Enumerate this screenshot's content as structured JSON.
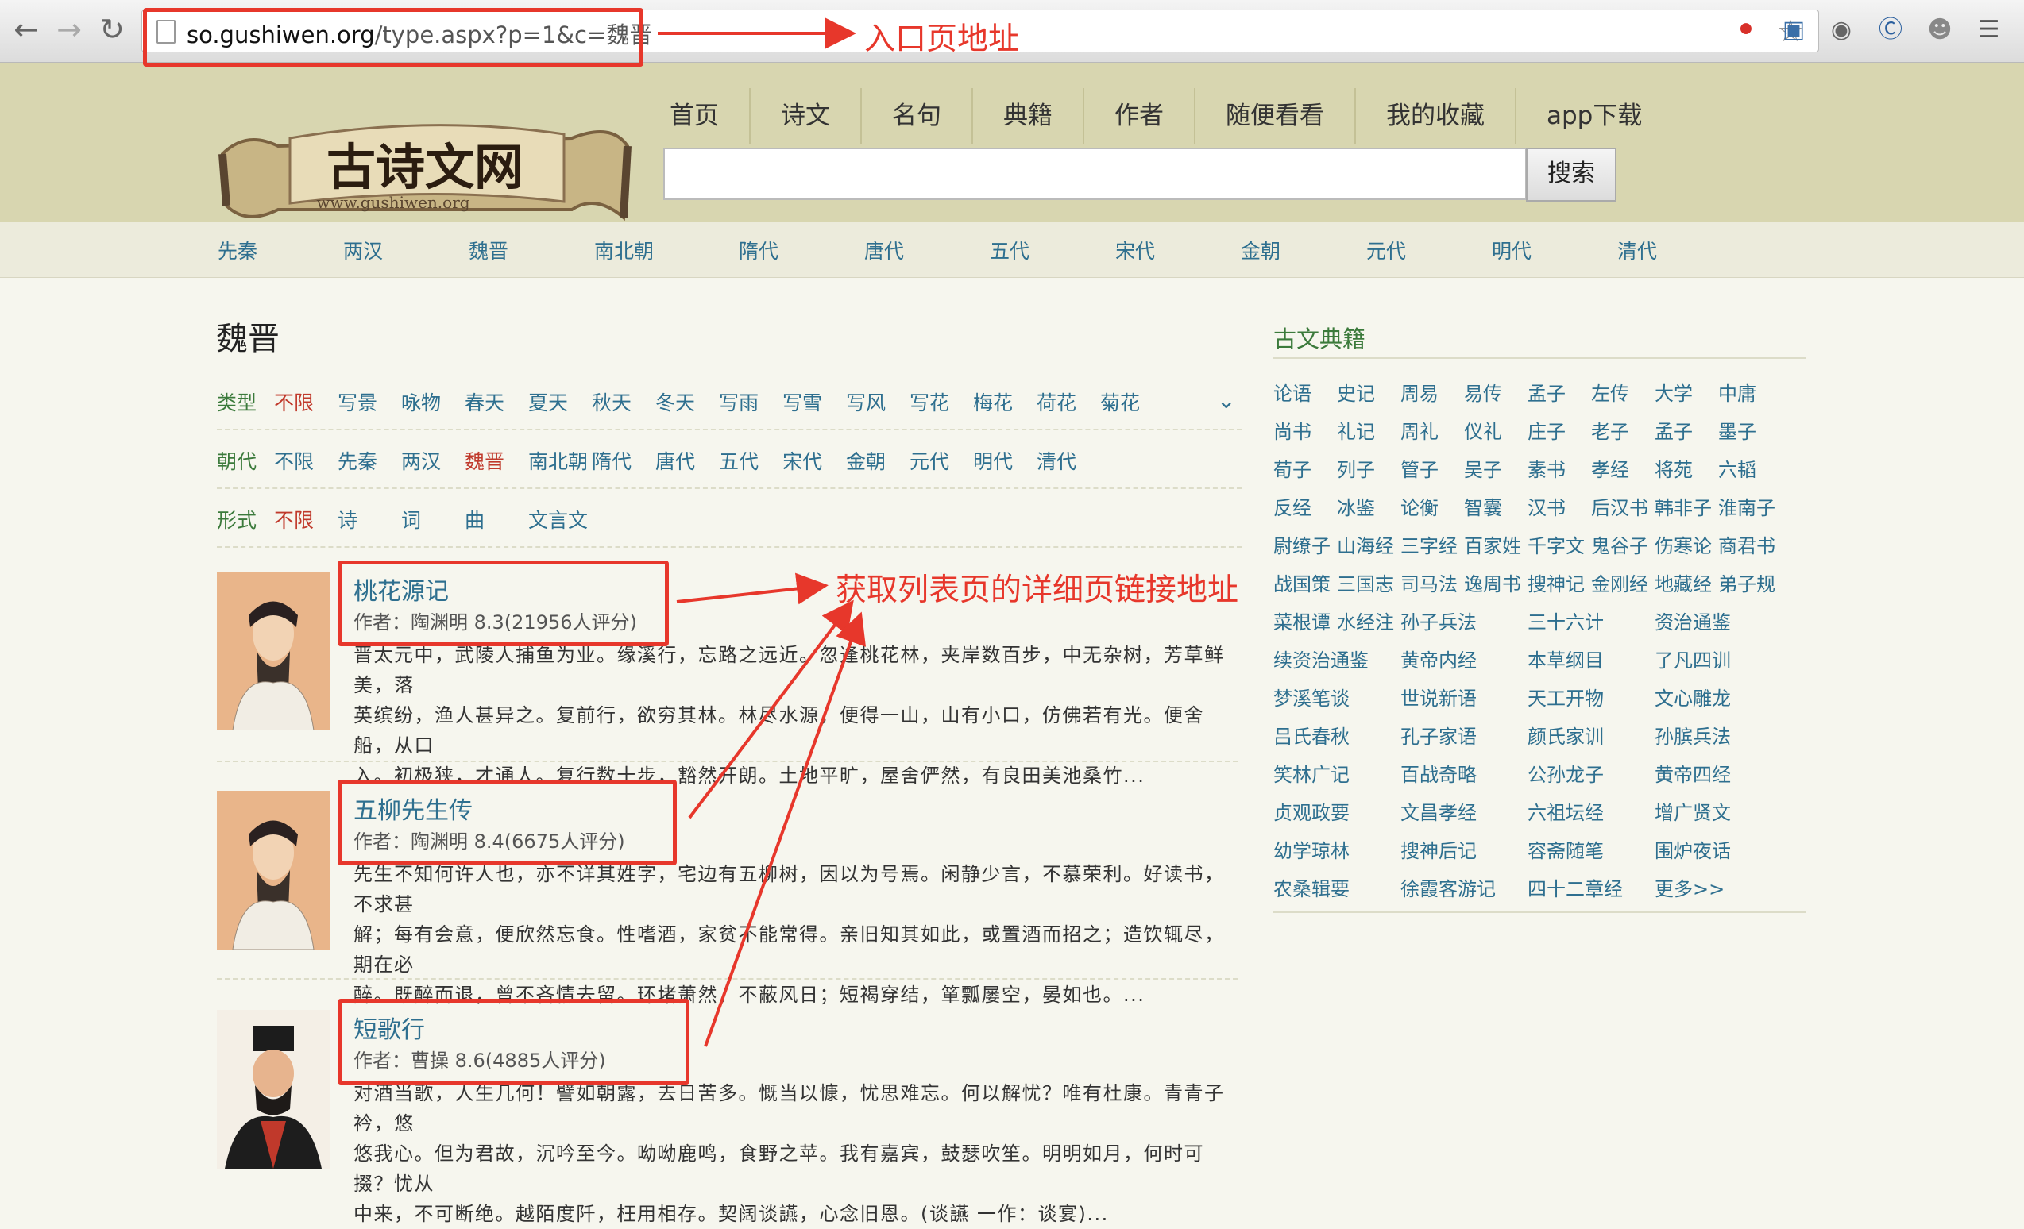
{
  "browser": {
    "url_host": "so.gushiwen.org",
    "url_path": "/type.aspx?p=1&c=魏晋"
  },
  "site": {
    "logo_text": "古诗文网",
    "logo_sub": "www.gushiwen.org",
    "nav": [
      "首页",
      "诗文",
      "名句",
      "典籍",
      "作者",
      "随便看看",
      "我的收藏",
      "app下载"
    ],
    "search_button": "搜索",
    "search_placeholder": ""
  },
  "dynasties": [
    "先秦",
    "两汉",
    "魏晋",
    "南北朝",
    "隋代",
    "唐代",
    "五代",
    "宋代",
    "金朝",
    "元代",
    "明代",
    "清代"
  ],
  "main": {
    "title": "魏晋",
    "filters": {
      "type_label": "类型",
      "type_items": [
        "不限",
        "写景",
        "咏物",
        "春天",
        "夏天",
        "秋天",
        "冬天",
        "写雨",
        "写雪",
        "写风",
        "写花",
        "梅花",
        "荷花",
        "菊花"
      ],
      "era_label": "朝代",
      "era_items": [
        "不限",
        "先秦",
        "两汉",
        "魏晋",
        "南北朝",
        "隋代",
        "唐代",
        "五代",
        "宋代",
        "金朝",
        "元代",
        "明代",
        "清代"
      ],
      "form_label": "形式",
      "form_items": [
        "不限",
        "诗",
        "词",
        "曲",
        "文言文"
      ]
    },
    "poems": [
      {
        "title": "桃花源记",
        "meta": "作者：陶渊明  8.3(21956人评分)",
        "lines": [
          "晋太元中，武陵人捕鱼为业。缘溪行，忘路之远近。忽逢桃花林，夹岸数百步，中无杂树，芳草鲜美，落",
          "英缤纷，渔人甚异之。复前行，欲穷其林。林尽水源，便得一山，山有小口，仿佛若有光。便舍船，从口",
          "入。初极狭，才通人。复行数十步，豁然开朗。土地平旷，屋舍俨然，有良田美池桑竹..."
        ]
      },
      {
        "title": "五柳先生传",
        "meta": "作者：陶渊明  8.4(6675人评分)",
        "lines": [
          "先生不知何许人也，亦不详其姓字，宅边有五柳树，因以为号焉。闲静少言，不慕荣利。好读书，不求甚",
          "解；每有会意，便欣然忘食。性嗜酒，家贫不能常得。亲旧知其如此，或置酒而招之；造饮辄尽，期在必",
          "醉。既醉而退，曾不吝情去留。环堵萧然，不蔽风日；短褐穿结，箪瓢屡空，晏如也。..."
        ]
      },
      {
        "title": "短歌行",
        "meta": "作者：曹操  8.6(4885人评分)",
        "lines": [
          "对酒当歌，人生几何！譬如朝露，去日苦多。慨当以慷，忧思难忘。何以解忧？唯有杜康。青青子衿，悠",
          "悠我心。但为君故，沉吟至今。呦呦鹿鸣，食野之苹。我有嘉宾，鼓瑟吹笙。明明如月，何时可掇？忧从",
          "中来，不可断绝。越陌度阡，枉用相存。契阔谈讌，心念旧恩。(谈讌 一作：谈宴)..."
        ]
      }
    ]
  },
  "sidebar": {
    "title": "古文典籍",
    "row1": [
      "论语",
      "史记",
      "周易",
      "易传",
      "孟子",
      "左传",
      "大学",
      "中庸"
    ],
    "row2": [
      "尚书",
      "礼记",
      "周礼",
      "仪礼",
      "庄子",
      "老子",
      "孟子",
      "墨子"
    ],
    "row3": [
      "荀子",
      "列子",
      "管子",
      "吴子",
      "素书",
      "孝经",
      "将苑",
      "六韬"
    ],
    "row4": [
      "反经",
      "冰鉴",
      "论衡",
      "智囊",
      "汉书",
      "后汉书",
      "韩非子",
      "淮南子"
    ],
    "row5": [
      "尉缭子",
      "山海经",
      "三字经",
      "百家姓",
      "千字文",
      "鬼谷子",
      "伤寒论",
      "商君书"
    ],
    "row6": [
      "战国策",
      "三国志",
      "司马法",
      "逸周书",
      "搜神记",
      "金刚经",
      "地藏经",
      "弟子规"
    ],
    "wide": [
      [
        "菜根谭",
        "水经注",
        "孙子兵法",
        "三十六计",
        "资治通鉴"
      ],
      [
        "续资治通鉴",
        "黄帝内经",
        "本草纲目",
        "了凡四训"
      ],
      [
        "梦溪笔谈",
        "世说新语",
        "天工开物",
        "文心雕龙"
      ],
      [
        "吕氏春秋",
        "孔子家语",
        "颜氏家训",
        "孙膑兵法"
      ],
      [
        "笑林广记",
        "百战奇略",
        "公孙龙子",
        "黄帝四经"
      ],
      [
        "贞观政要",
        "文昌孝经",
        "六祖坛经",
        "增广贤文"
      ],
      [
        "幼学琼林",
        "搜神后记",
        "容斋随笔",
        "围炉夜话"
      ],
      [
        "农桑辑要",
        "徐霞客游记",
        "四十二章经",
        "更多>>"
      ]
    ]
  },
  "annotations": {
    "entry_label": "入口页地址",
    "detail_label": "获取列表页的详细页链接地址",
    "color": "#e7372b"
  }
}
